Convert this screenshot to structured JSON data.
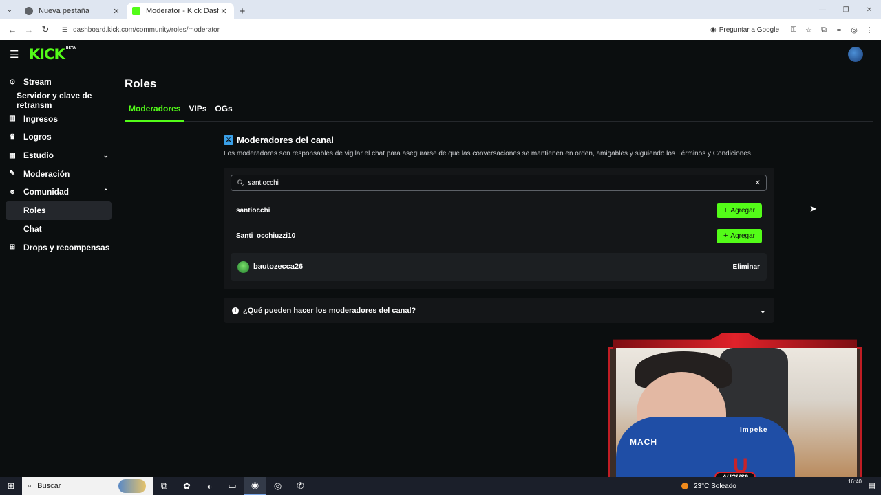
{
  "browser": {
    "tabs": [
      {
        "title": "Nueva pestaña",
        "active": false
      },
      {
        "title": "Moderator - Kick Dashboard",
        "active": true
      }
    ],
    "url": "dashboard.kick.com/community/roles/moderator",
    "ask_google": "Preguntar a Google"
  },
  "app": {
    "logo": "KICK",
    "logo_tag": "BETA"
  },
  "sidebar": {
    "items": [
      {
        "label": "Stream",
        "icon": "broadcast-icon"
      },
      {
        "label": "Servidor y clave de retransm",
        "icon": ""
      },
      {
        "label": "Ingresos",
        "icon": "chart-icon"
      },
      {
        "label": "Logros",
        "icon": "trophy-icon"
      },
      {
        "label": "Estudio",
        "icon": "grid-icon"
      },
      {
        "label": "Moderación",
        "icon": "hammer-icon"
      },
      {
        "label": "Comunidad",
        "icon": "users-icon"
      },
      {
        "label": "Roles",
        "icon": ""
      },
      {
        "label": "Chat",
        "icon": ""
      },
      {
        "label": "Drops y recompensas",
        "icon": "gift-icon"
      }
    ]
  },
  "page": {
    "title": "Roles",
    "tabs": [
      "Moderadores",
      "VIPs",
      "OGs"
    ],
    "section_title": "Moderadores del canal",
    "section_desc": "Los moderadores son responsables de vigilar el chat para asegurarse de que las conversaciones se mantienen en orden, amigables y siguiendo los Términos y Condiciones.",
    "search_value": "santiocchi",
    "results": [
      {
        "name": "santiocchi",
        "button": "Agregar"
      },
      {
        "name": "Santi_occhiuzzi10",
        "button": "Agregar"
      }
    ],
    "moderators": [
      {
        "name": "bautozecca26",
        "button": "Eliminar"
      }
    ],
    "faq": "¿Qué pueden hacer los moderadores del canal?"
  },
  "webcam": {
    "name_tag": "AUGUS9",
    "shirt_sponsor": "MACH",
    "shirt_sponsor2": "Impeke"
  },
  "taskbar": {
    "search_label": "Buscar",
    "weather": "23°C  Soleado",
    "time": "16:40"
  },
  "colors": {
    "accent": "#53fc18",
    "background": "#0b0e0f",
    "card": "#141618"
  }
}
